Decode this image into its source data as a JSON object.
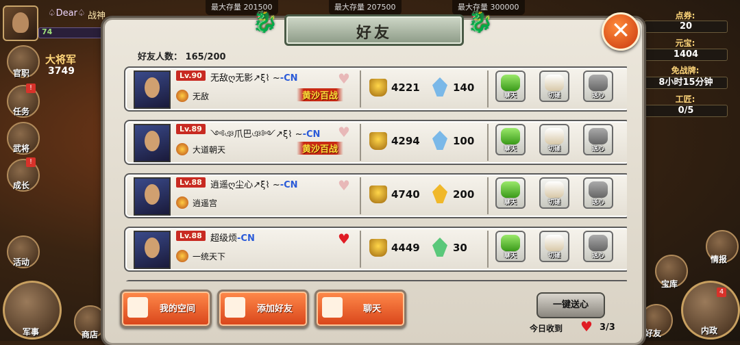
{
  "hud": {
    "player_name": "♤Dear♤",
    "player_title": "战神",
    "level": "74",
    "rank_label": "大将军",
    "rank_value": "3749",
    "side_left": [
      {
        "label": "官职",
        "badge": ""
      },
      {
        "label": "任务",
        "badge": "!"
      },
      {
        "label": "武将",
        "badge": ""
      },
      {
        "label": "成长",
        "badge": "!"
      },
      {
        "label": "活动",
        "badge": ""
      }
    ],
    "bottom_left": [
      {
        "label": "军事"
      },
      {
        "label": "商店"
      }
    ],
    "top_resources": [
      "最大存量 201500",
      "最大存量 207500",
      "最大存量 300000"
    ],
    "right_stats": [
      {
        "label": "点券:",
        "value": "20"
      },
      {
        "label": "元宝:",
        "value": "1404"
      },
      {
        "label": "免战牌:",
        "value": "8小时15分钟"
      },
      {
        "label": "工匠:",
        "value": "0/5"
      }
    ],
    "right_buttons": [
      {
        "label": "情报"
      },
      {
        "label": "宝库"
      },
      {
        "label": "好友"
      },
      {
        "label": "内政",
        "badge": "4"
      }
    ]
  },
  "panel": {
    "title": "好友",
    "close_label": "✕",
    "friend_count_label": "好友人数：",
    "friend_count_value": "165/200"
  },
  "friends": [
    {
      "level": "Lv.90",
      "name": "无敌ღ无影",
      "suffix": "↗ξ⌇ ~",
      "cn": "-CN",
      "guild": "无敌",
      "tag": "黄沙百战",
      "power": "4221",
      "gem_value": "140",
      "gem_color": "#7ab8e8",
      "hearted": false,
      "actions": [
        "聊天",
        "切磋",
        "送心"
      ]
    },
    {
      "level": "Lv.89",
      "name": "༺ঞ爪巴ঞ༻",
      "suffix": "↗ξ⌇ ~",
      "cn": "-CN",
      "guild": "大道朝天",
      "tag": "黄沙百战",
      "power": "4294",
      "gem_value": "100",
      "gem_color": "#7ab8e8",
      "hearted": false,
      "actions": [
        "聊天",
        "切磋",
        "送心"
      ]
    },
    {
      "level": "Lv.88",
      "name": "逍遥ღ尘心",
      "suffix": "↗ξ⌇ ~",
      "cn": "-CN",
      "guild": "逍遥宫",
      "tag": "",
      "power": "4740",
      "gem_value": "200",
      "gem_color": "#f0b82a",
      "hearted": false,
      "actions": [
        "聊天",
        "切磋",
        "送心"
      ]
    },
    {
      "level": "Lv.88",
      "name": "超级烦",
      "suffix": "",
      "cn": "-CN",
      "guild": "一统天下",
      "tag": "",
      "power": "4449",
      "gem_value": "30",
      "gem_color": "#5ac87a",
      "hearted": true,
      "actions": [
        "聊天",
        "切磋",
        "送心"
      ]
    }
  ],
  "bottom": {
    "my_space": "我的空间",
    "add_friend": "添加好友",
    "chat": "聊天",
    "gift_all": "一键送心",
    "today_label": "今日收到",
    "today_count": "3/3"
  },
  "colors": {
    "accent": "#d8441a",
    "heart_on": "#e01c24",
    "cn_blue": "#2a5ad8",
    "level_red": "#c82a22"
  }
}
